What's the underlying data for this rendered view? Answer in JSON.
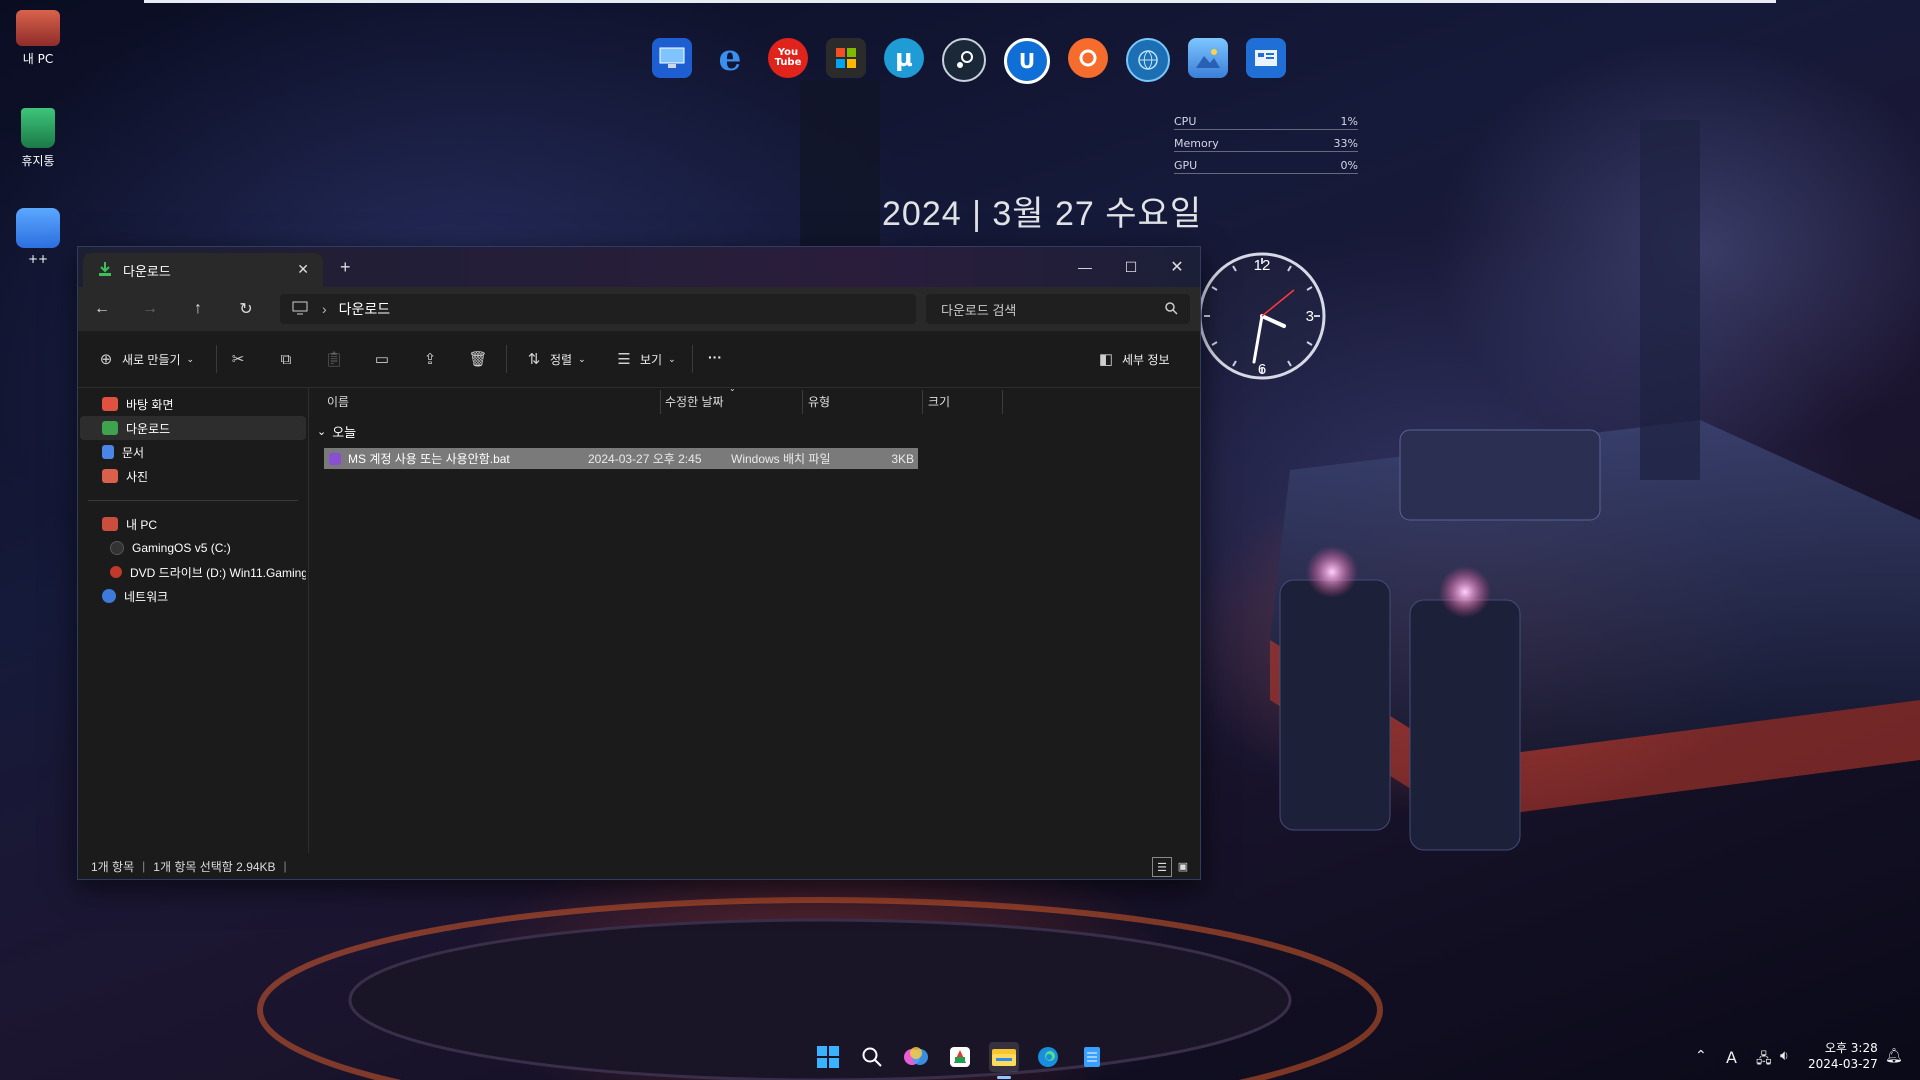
{
  "desktop": {
    "icons": [
      {
        "label": "내 PC",
        "icon": "monitor-icon"
      },
      {
        "label": "휴지통",
        "icon": "recycle-bin-icon"
      },
      {
        "label": "++",
        "icon": "folder-icon"
      }
    ]
  },
  "dock": {
    "items": [
      {
        "icon": "this-pc-icon"
      },
      {
        "icon": "edge-legacy-icon",
        "glyph": "e"
      },
      {
        "icon": "youtube-icon",
        "glyph": "You Tube"
      },
      {
        "icon": "microsoft-store-icon"
      },
      {
        "icon": "utorrent-icon",
        "glyph": "µ"
      },
      {
        "icon": "steam-icon"
      },
      {
        "icon": "uplay-icon",
        "glyph": "U"
      },
      {
        "icon": "origin-icon"
      },
      {
        "icon": "network-globe-icon"
      },
      {
        "icon": "photos-icon"
      },
      {
        "icon": "control-panel-icon"
      }
    ]
  },
  "perf": {
    "rows": [
      {
        "label": "CPU",
        "value": "1%"
      },
      {
        "label": "Memory",
        "value": "33%"
      },
      {
        "label": "GPU",
        "value": "0%"
      }
    ]
  },
  "datewidget": {
    "text": "2024 | 3월 27 수요일"
  },
  "clock": {
    "n12": "12",
    "n3": "3",
    "n6": "6"
  },
  "explorer": {
    "tab_title": "다운로드",
    "address": {
      "path": "다운로드"
    },
    "search": {
      "placeholder": "다운로드 검색"
    },
    "toolbar": {
      "new_label": "새로 만들기",
      "sort_label": "정렬",
      "view_label": "보기",
      "more_label": "···",
      "details_label": "세부 정보"
    },
    "nav": {
      "quick": [
        {
          "label": "바탕 화면",
          "color": "#e0523f"
        },
        {
          "label": "다운로드",
          "color": "#3fa34d"
        },
        {
          "label": "문서",
          "color": "#4a86e8"
        },
        {
          "label": "사진",
          "color": "#d9604a"
        }
      ],
      "pc": [
        {
          "label": "내 PC",
          "color": "#c94e3d"
        },
        {
          "label": "GamingOS v5 (C:)",
          "color": "#333333"
        },
        {
          "label": "DVD 드라이브 (D:) Win11.Gaming",
          "color": "#c0392b"
        },
        {
          "label": "네트워크",
          "color": "#3d7ad9"
        }
      ]
    },
    "columns": {
      "name": "이름",
      "modified": "수정한 날짜",
      "type": "유형",
      "size": "크기"
    },
    "group_label": "오늘",
    "files": [
      {
        "name": "MS 계정 사용 또는 사용안함.bat",
        "modified": "2024-03-27 오후 2:45",
        "type": "Windows 배치 파일",
        "size": "3KB"
      }
    ],
    "status": {
      "count": "1개 항목",
      "selected": "1개 항목 선택함 2.94KB"
    }
  },
  "taskbar": {
    "items": [
      {
        "icon": "start-icon"
      },
      {
        "icon": "search-icon"
      },
      {
        "icon": "copilot-icon"
      },
      {
        "icon": "office-icon"
      },
      {
        "icon": "file-explorer-icon"
      },
      {
        "icon": "edge-icon"
      },
      {
        "icon": "notepad-icon"
      }
    ],
    "tray": {
      "ime": "A"
    },
    "clock": {
      "time": "오후 3:28",
      "date": "2024-03-27"
    }
  }
}
